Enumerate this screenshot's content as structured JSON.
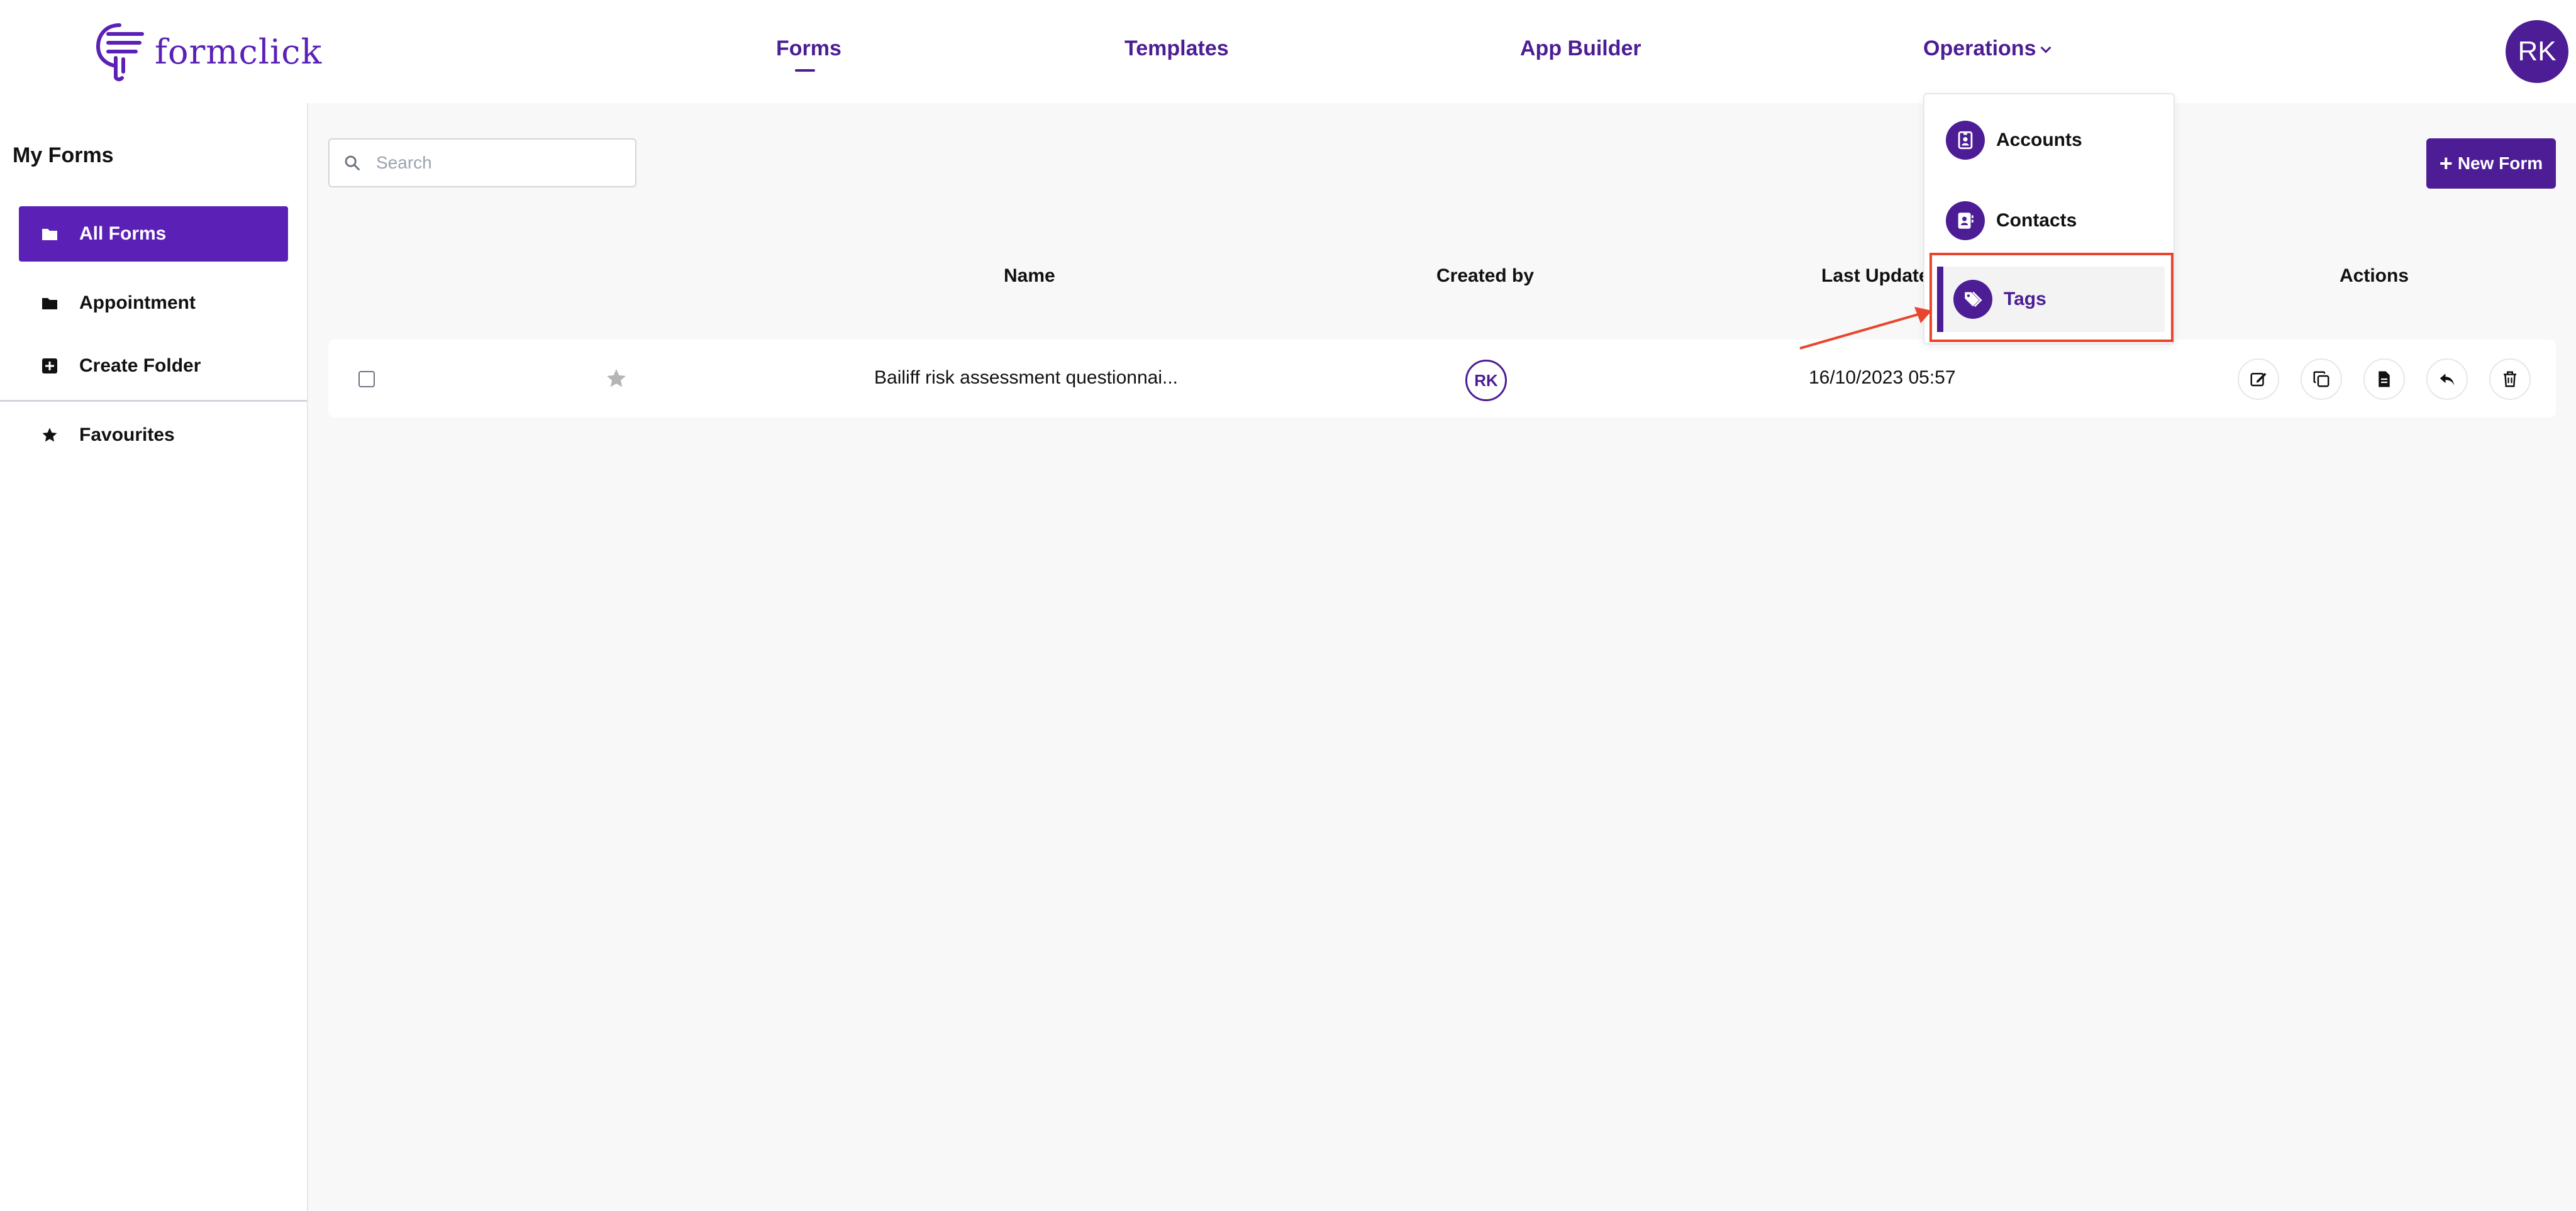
{
  "header": {
    "brand": "formclick",
    "nav": {
      "forms": "Forms",
      "templates": "Templates",
      "app_builder": "App Builder",
      "operations": "Operations"
    },
    "user_initials": "RK"
  },
  "operations_menu": {
    "accounts": "Accounts",
    "contacts": "Contacts",
    "tags": "Tags"
  },
  "sidebar": {
    "title": "My Forms",
    "items": {
      "all_forms": "All Forms",
      "appointment": "Appointment",
      "create_folder": "Create Folder",
      "favourites": "Favourites"
    }
  },
  "main": {
    "search_placeholder": "Search",
    "new_form": "New Form",
    "columns": {
      "name": "Name",
      "created_by": "Created by",
      "last_updated": "Last Update",
      "actions": "Actions"
    },
    "rows": [
      {
        "name": "Bailiff risk assessment questionnai...",
        "created_by": "RK",
        "last_updated": "16/10/2023 05:57"
      }
    ]
  },
  "colors": {
    "brand": "#4c1d95",
    "active_sidebar": "#5b21b6",
    "annotation": "#e8452c"
  }
}
